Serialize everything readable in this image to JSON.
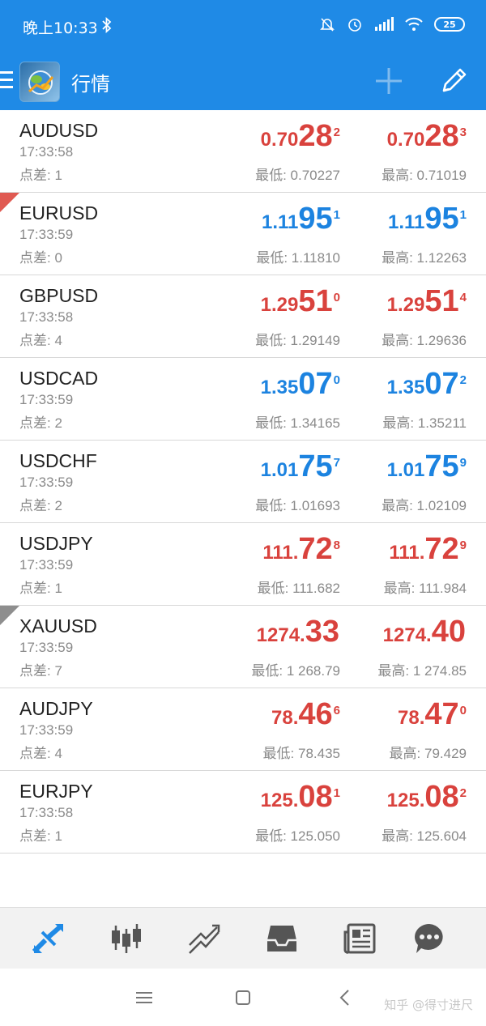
{
  "status_bar": {
    "time": "晚上10:33",
    "battery": "25"
  },
  "app_bar": {
    "title": "行情"
  },
  "quotes": [
    {
      "symbol": "AUDUSD",
      "time": "17:33:58",
      "spread": "点差: 1",
      "color": "red",
      "corner": "",
      "bid": {
        "small": "0.70",
        "big": "28",
        "sup": "2"
      },
      "ask": {
        "small": "0.70",
        "big": "28",
        "sup": "3"
      },
      "low": "最低: 0.70227",
      "high": "最高: 0.71019"
    },
    {
      "symbol": "EURUSD",
      "time": "17:33:59",
      "spread": "点差: 0",
      "color": "blue",
      "corner": "red",
      "bid": {
        "small": "1.11",
        "big": "95",
        "sup": "1"
      },
      "ask": {
        "small": "1.11",
        "big": "95",
        "sup": "1"
      },
      "low": "最低: 1.11810",
      "high": "最高: 1.12263"
    },
    {
      "symbol": "GBPUSD",
      "time": "17:33:58",
      "spread": "点差: 4",
      "color": "red",
      "corner": "",
      "bid": {
        "small": "1.29",
        "big": "51",
        "sup": "0"
      },
      "ask": {
        "small": "1.29",
        "big": "51",
        "sup": "4"
      },
      "low": "最低: 1.29149",
      "high": "最高: 1.29636"
    },
    {
      "symbol": "USDCAD",
      "time": "17:33:59",
      "spread": "点差: 2",
      "color": "blue",
      "corner": "",
      "bid": {
        "small": "1.35",
        "big": "07",
        "sup": "0"
      },
      "ask": {
        "small": "1.35",
        "big": "07",
        "sup": "2"
      },
      "low": "最低: 1.34165",
      "high": "最高: 1.35211"
    },
    {
      "symbol": "USDCHF",
      "time": "17:33:59",
      "spread": "点差: 2",
      "color": "blue",
      "corner": "",
      "bid": {
        "small": "1.01",
        "big": "75",
        "sup": "7"
      },
      "ask": {
        "small": "1.01",
        "big": "75",
        "sup": "9"
      },
      "low": "最低: 1.01693",
      "high": "最高: 1.02109"
    },
    {
      "symbol": "USDJPY",
      "time": "17:33:59",
      "spread": "点差: 1",
      "color": "red",
      "corner": "",
      "bid": {
        "small": "111.",
        "big": "72",
        "sup": "8"
      },
      "ask": {
        "small": "111.",
        "big": "72",
        "sup": "9"
      },
      "low": "最低: 111.682",
      "high": "最高: 111.984"
    },
    {
      "symbol": "XAUUSD",
      "time": "17:33:59",
      "spread": "点差: 7",
      "color": "red",
      "corner": "grey",
      "bid": {
        "small": "1274.",
        "big": "33",
        "sup": ""
      },
      "ask": {
        "small": "1274.",
        "big": "40",
        "sup": ""
      },
      "low": "最低: 1 268.79",
      "high": "最高: 1 274.85"
    },
    {
      "symbol": "AUDJPY",
      "time": "17:33:59",
      "spread": "点差: 4",
      "color": "red",
      "corner": "",
      "bid": {
        "small": "78.",
        "big": "46",
        "sup": "6"
      },
      "ask": {
        "small": "78.",
        "big": "47",
        "sup": "0"
      },
      "low": "最低: 78.435",
      "high": "最高: 79.429"
    },
    {
      "symbol": "EURJPY",
      "time": "17:33:58",
      "spread": "点差: 1",
      "color": "red",
      "corner": "",
      "bid": {
        "small": "125.",
        "big": "08",
        "sup": "1"
      },
      "ask": {
        "small": "125.",
        "big": "08",
        "sup": "2"
      },
      "low": "最低: 125.050",
      "high": "最高: 125.604"
    }
  ],
  "bottom_nav": {
    "items": [
      "quotes-icon",
      "chart-icon",
      "trade-icon",
      "history-icon",
      "news-icon",
      "chat-icon"
    ],
    "active": 0
  },
  "watermark": "知乎 @得寸进尺",
  "colors": {
    "accent": "#1f8ae6",
    "red": "#d9423d",
    "blue": "#1c83e0"
  }
}
